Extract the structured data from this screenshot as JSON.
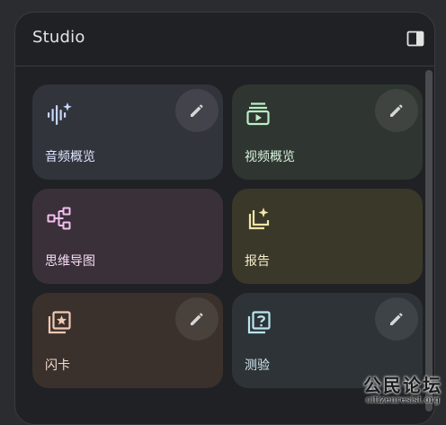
{
  "panel": {
    "title": "Studio",
    "collapse_icon": "side-panel-icon"
  },
  "cards": [
    {
      "label": "音频概览",
      "icon": "audio-sparkle-icon",
      "bg": "#32343c",
      "icon_color": "#c7d6ff",
      "label_color": "#dfe6ff",
      "has_edit": true
    },
    {
      "label": "视频概览",
      "icon": "video-playlist-icon",
      "bg": "#2f3530",
      "icon_color": "#b9efc6",
      "label_color": "#d9f5df",
      "has_edit": true
    },
    {
      "label": "思维导图",
      "icon": "mind-map-icon",
      "bg": "#3a3039",
      "icon_color": "#f2c0f0",
      "label_color": "#f6dcf5",
      "has_edit": false
    },
    {
      "label": "报告",
      "icon": "report-sparkle-icon",
      "bg": "#3a3829",
      "icon_color": "#f1e6a6",
      "label_color": "#f4eccc",
      "has_edit": false
    },
    {
      "label": "闪卡",
      "icon": "flashcard-star-icon",
      "bg": "#3a312c",
      "icon_color": "#f3c8b4",
      "label_color": "#f5dccf",
      "has_edit": true
    },
    {
      "label": "测验",
      "icon": "quiz-question-icon",
      "bg": "#2e3338",
      "icon_color": "#b9e6f2",
      "label_color": "#d6eef5",
      "has_edit": true
    }
  ],
  "edit_icon": "pencil-icon",
  "watermark": {
    "title": "公民论坛",
    "url": "citizenresist.org"
  }
}
